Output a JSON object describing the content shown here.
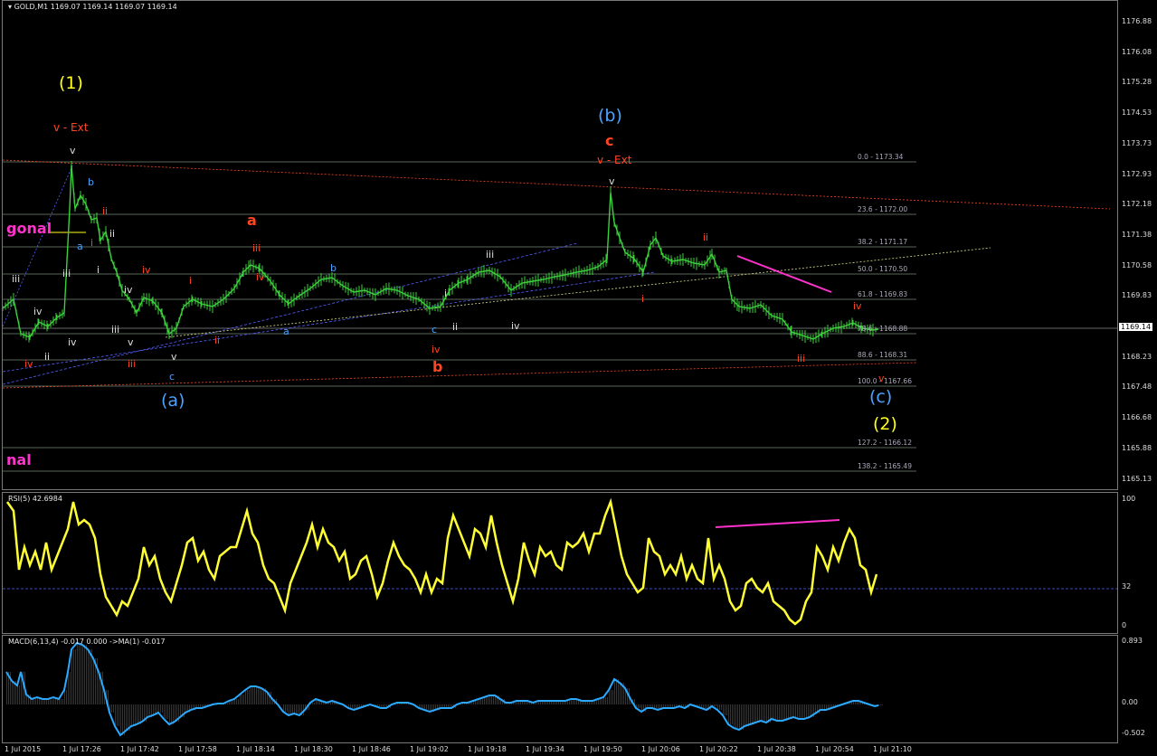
{
  "main": {
    "header": "GOLD,M1  1169.07 1169.14 1169.07 1169.14",
    "price_axis": [
      "1176.88",
      "1176.08",
      "1175.28",
      "1174.53",
      "1173.73",
      "1172.93",
      "1172.18",
      "1171.38",
      "1170.58",
      "1169.83",
      "1169.03",
      "1168.23",
      "1167.48",
      "1166.68",
      "1165.88",
      "1165.13"
    ],
    "current_price": "1169.14",
    "fib_levels": [
      "0.0 - 1173.34",
      "23.6 - 1172.00",
      "38.2 - 1171.17",
      "50.0 - 1170.50",
      "61.8 - 1169.83",
      "78.6 - 1168.88",
      "88.6 - 1168.31",
      "100.0 - 1167.66",
      "127.2 - 1166.12",
      "138.2 - 1165.49"
    ],
    "left_labels": [
      "gonal",
      "nal"
    ],
    "wave_labels": {
      "w1": "(1)",
      "w2": "(2)",
      "wa": "(a)",
      "wb": "(b)",
      "wc": "(c)",
      "red_a": "a",
      "red_b": "b",
      "red_c": "c",
      "vext1": "v - Ext",
      "vext2": "v - Ext"
    },
    "small_labels": [
      "v",
      "b",
      "ii",
      "i",
      "a",
      "ii",
      "i",
      "iii",
      "iii",
      "iv",
      "iv",
      "ii",
      "iii",
      "iv",
      "v",
      "iii",
      "iv",
      "v",
      "c",
      "i",
      "ii",
      "iii",
      "iv",
      "a",
      "b",
      "i",
      "c",
      "iv",
      "ii",
      "iii",
      "iv",
      "v",
      "i",
      "ii",
      "iv",
      "iii",
      "v",
      "iv"
    ]
  },
  "rsi": {
    "header": "RSI(5) 42.6984",
    "axis": [
      "100",
      "32",
      "0"
    ]
  },
  "macd": {
    "header": "MACD(6,13,4) -0.017 0.000  ->MA(1) -0.017",
    "axis": [
      "0.893",
      "0.00",
      "-0.502"
    ]
  },
  "time_axis": [
    "1 Jul 2015",
    "1 Jul 17:26",
    "1 Jul 17:42",
    "1 Jul 17:58",
    "1 Jul 18:14",
    "1 Jul 18:30",
    "1 Jul 18:46",
    "1 Jul 19:02",
    "1 Jul 19:18",
    "1 Jul 19:34",
    "1 Jul 19:50",
    "1 Jul 20:06",
    "1 Jul 20:22",
    "1 Jul 20:38",
    "1 Jul 20:54",
    "1 Jul 21:10"
  ],
  "colors": {
    "candles": "#3cd13c",
    "rsi": "#ffff33",
    "macd_hist": "#1020ff",
    "macd_signal": "#2aa9ff",
    "fib": "#778877",
    "wave_yellow": "#ffff22",
    "wave_blue": "#4aa3ff",
    "wave_orange": "#ff4422",
    "magenta": "#ff33cc"
  }
}
